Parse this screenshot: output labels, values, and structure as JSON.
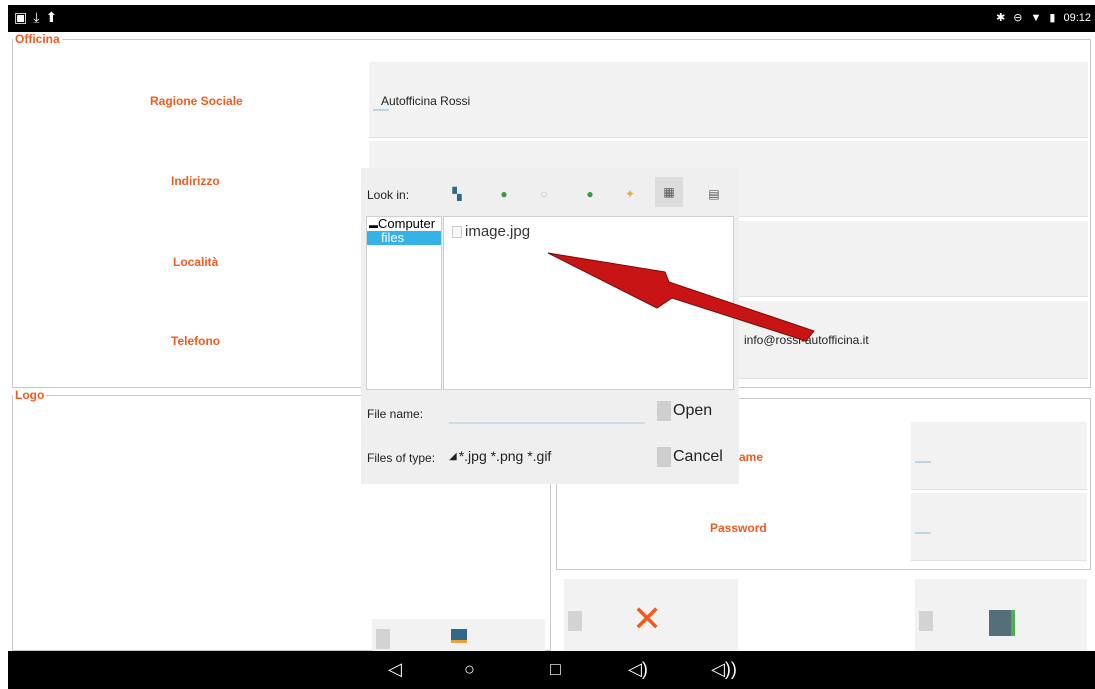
{
  "status_bar": {
    "left_icons": [
      "image-icon",
      "download-icon",
      "upload-icon"
    ],
    "right_icons": [
      "bluetooth-icon",
      "do-not-disturb-icon",
      "wifi-icon",
      "battery-icon"
    ],
    "time": "09:12"
  },
  "officina": {
    "legend": "Officina",
    "fields": [
      {
        "label": "Ragione Sociale",
        "value": "Autofficina Rossi"
      },
      {
        "label": "Indirizzo",
        "value": ""
      },
      {
        "label": "Località",
        "value": ""
      },
      {
        "label": "Telefono",
        "value": "info@rossi-autofficina.it"
      }
    ]
  },
  "logo": {
    "legend": "Logo",
    "pick_image_icon": "image-pick-icon"
  },
  "credentials": {
    "username_label": "ame",
    "password_label": "Password"
  },
  "actions": {
    "cancel_icon": "close-icon",
    "save_icon": "save-icon"
  },
  "file_dialog": {
    "look_in_label": "Look in:",
    "toolbar_icons": [
      "drive-icon",
      "back-icon",
      "forward-icon",
      "up-icon",
      "new-folder-icon",
      "list-view-icon",
      "detail-view-icon"
    ],
    "sidebar": [
      "Computer",
      "files"
    ],
    "files": [
      "image.jpg"
    ],
    "file_name_label": "File name:",
    "file_name_value": "",
    "files_of_type_label": "Files of type:",
    "files_of_type_value": "*.jpg *.png *.gif",
    "open_label": "Open",
    "cancel_label": "Cancel"
  },
  "nav_bar": {
    "buttons": [
      "back-icon",
      "home-icon",
      "recents-icon",
      "volume-down-icon",
      "volume-up-icon"
    ]
  },
  "colors": {
    "accent": "#f25a1f",
    "field_bg": "#f2f2f2",
    "selection": "#36b3e6",
    "arrow": "#c81414"
  }
}
